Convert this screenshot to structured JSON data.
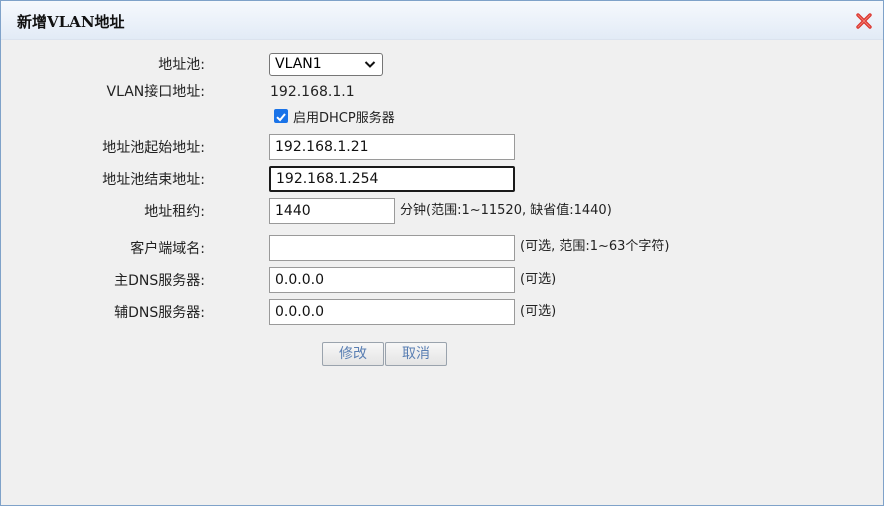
{
  "dialog": {
    "title": "新增VLAN地址",
    "close_icon": "close-x-icon",
    "accent_close_color": "#d9312b"
  },
  "form": {
    "pool_label": "地址池:",
    "pool_selected": "VLAN1",
    "vlan_if_label": "VLAN接口地址:",
    "vlan_if_value": "192.168.1.1",
    "dhcp_checkbox_label": "启用DHCP服务器",
    "dhcp_checked": true,
    "start_label": "地址池起始地址:",
    "start_value": "192.168.1.21",
    "end_label": "地址池结束地址:",
    "end_value": "192.168.1.254",
    "lease_label": "地址租约:",
    "lease_value": "1440",
    "lease_note": "分钟(范围:1~11520, 缺省值:1440)",
    "domain_label": "客户端域名:",
    "domain_value": "",
    "domain_note": "(可选, 范围:1~63个字符)",
    "dns1_label": "主DNS服务器:",
    "dns1_value": "0.0.0.0",
    "dns1_note": "(可选)",
    "dns2_label": "辅DNS服务器:",
    "dns2_value": "0.0.0.0",
    "dns2_note": "(可选)"
  },
  "buttons": {
    "modify": "修改",
    "cancel": "取消"
  }
}
